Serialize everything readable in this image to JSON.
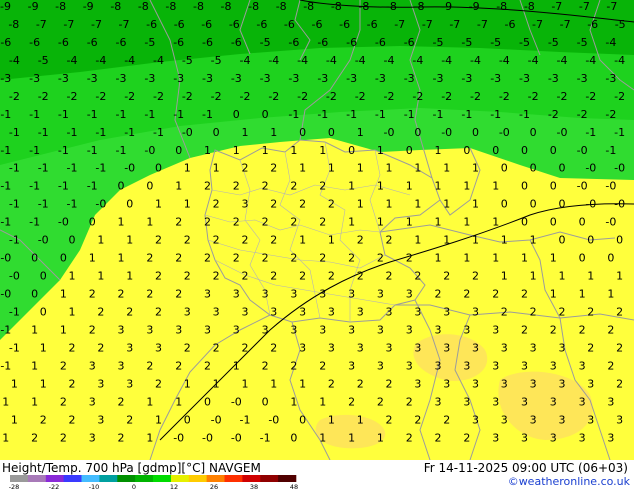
{
  "title": {
    "left": "Height/Temp. 700 hPa [gdmp][°C] NAVGEM",
    "right": "Fr 14-11-2025 09:00 UTC (06+03)"
  },
  "credit": "©weatheronline.co.uk",
  "colorbar": {
    "labels": [
      "-28",
      "-22",
      "-10",
      "0",
      "12",
      "26",
      "38",
      "48"
    ],
    "colors": [
      "#9a9a9a",
      "#a87ab8",
      "#8a2ad8",
      "#3a3aff",
      "#44bcff",
      "#00a0a0",
      "#009000",
      "#00b400",
      "#00dc00",
      "#e6f000",
      "#ffcc00",
      "#ff8000",
      "#ff3000",
      "#d00000",
      "#900000",
      "#500000"
    ]
  },
  "palette": {
    "dark_green": "#08b408",
    "mid_green": "#1ed21e",
    "light_green": "#30dc30",
    "yellow": "#ffff3c",
    "orange_yellow": "#fee658",
    "border_gray": "#9c9c9c"
  },
  "isotherm_rows": [
    [
      "-9",
      "-9",
      "-8",
      "-9",
      "-8",
      "-8",
      "-8",
      "-8",
      "-8",
      "-8",
      "-8",
      "-8",
      "-8",
      "-8",
      "-8",
      "-8",
      "-9",
      "-9",
      "-8",
      "-8",
      "-7",
      "-7",
      "-7"
    ],
    [
      "-8",
      "-7",
      "-7",
      "-7",
      "-7",
      "-6",
      "-6",
      "-6",
      "-6",
      "-6",
      "-6",
      "-6",
      "-6",
      "-6",
      "-7",
      "-7",
      "-7",
      "-7",
      "-6",
      "-7",
      "-7",
      "-6",
      "-5"
    ],
    [
      "-6",
      "-6",
      "-6",
      "-6",
      "-6",
      "-5",
      "-6",
      "-6",
      "-6",
      "-5",
      "-6",
      "-6",
      "-6",
      "-6",
      "-6",
      "-5",
      "-5",
      "-5",
      "-5",
      "-5",
      "-5",
      "-4"
    ],
    [
      "-4",
      "-5",
      "-4",
      "-4",
      "-4",
      "-4",
      "-5",
      "-5",
      "-4",
      "-4",
      "-4",
      "-4",
      "-4",
      "-4",
      "-4",
      "-4",
      "-4",
      "-4",
      "-4",
      "-4",
      "-4",
      "-4"
    ],
    [
      "-3",
      "-3",
      "-3",
      "-3",
      "-3",
      "-3",
      "-3",
      "-3",
      "-3",
      "-3",
      "-3",
      "-3",
      "-3",
      "-3",
      "-3",
      "-3",
      "-3",
      "-3",
      "-3",
      "-3",
      "-3",
      "-3"
    ],
    [
      "-2",
      "-2",
      "-2",
      "-2",
      "-2",
      "-2",
      "-2",
      "-2",
      "-2",
      "-2",
      "-2",
      "-2",
      "-2",
      "-2",
      "-2",
      "-2",
      "-2",
      "-2",
      "-2",
      "-2",
      "-2",
      "-2"
    ],
    [
      "-1",
      "-1",
      "-1",
      "-1",
      "-1",
      "-1",
      "-1",
      "-1",
      "0",
      "0",
      "-1",
      "-1",
      "-1",
      "-1",
      "-1",
      "-1",
      "-1",
      "-1",
      "-1",
      "-2",
      "-2",
      "-2"
    ],
    [
      "-1",
      "-1",
      "-1",
      "-1",
      "-1",
      "-1",
      "-0",
      "0",
      "1",
      "1",
      "0",
      "0",
      "1",
      "-0",
      "0",
      "-0",
      "0",
      "-0",
      "0",
      "-0",
      "-1",
      "-1"
    ],
    [
      "-1",
      "-1",
      "-1",
      "-1",
      "-1",
      "-0",
      "0",
      "1",
      "1",
      "1",
      "1",
      "1",
      "0",
      "1",
      "0",
      "1",
      "0",
      "0",
      "0",
      "0",
      "-0",
      "-1"
    ],
    [
      "-1",
      "-1",
      "-1",
      "-1",
      "-0",
      "0",
      "1",
      "1",
      "2",
      "2",
      "1",
      "1",
      "1",
      "1",
      "1",
      "1",
      "1",
      "0",
      "0",
      "0",
      "-0",
      "-0"
    ],
    [
      "-1",
      "-1",
      "-1",
      "-1",
      "0",
      "0",
      "1",
      "2",
      "2",
      "2",
      "2",
      "2",
      "1",
      "1",
      "1",
      "1",
      "1",
      "1",
      "0",
      "0",
      "-0",
      "-0"
    ],
    [
      "-1",
      "-1",
      "-1",
      "-0",
      "0",
      "1",
      "1",
      "2",
      "3",
      "2",
      "2",
      "2",
      "1",
      "1",
      "1",
      "1",
      "1",
      "0",
      "0",
      "0",
      "-0",
      "-0"
    ],
    [
      "-1",
      "-1",
      "-0",
      "0",
      "1",
      "1",
      "2",
      "2",
      "2",
      "2",
      "2",
      "2",
      "1",
      "1",
      "1",
      "1",
      "1",
      "1",
      "0",
      "0",
      "0",
      "-0"
    ],
    [
      "-1",
      "-0",
      "0",
      "1",
      "1",
      "2",
      "2",
      "2",
      "2",
      "2",
      "1",
      "1",
      "2",
      "2",
      "1",
      "1",
      "1",
      "1",
      "1",
      "0",
      "0",
      "0"
    ],
    [
      "-0",
      "0",
      "0",
      "1",
      "1",
      "2",
      "2",
      "2",
      "2",
      "2",
      "2",
      "2",
      "2",
      "2",
      "2",
      "1",
      "1",
      "1",
      "1",
      "1",
      "0",
      "0"
    ],
    [
      "-0",
      "0",
      "1",
      "1",
      "1",
      "2",
      "2",
      "2",
      "2",
      "2",
      "2",
      "2",
      "2",
      "2",
      "2",
      "2",
      "2",
      "1",
      "1",
      "1",
      "1",
      "1"
    ],
    [
      "-0",
      "0",
      "1",
      "2",
      "2",
      "2",
      "2",
      "3",
      "3",
      "3",
      "3",
      "3",
      "3",
      "3",
      "3",
      "2",
      "2",
      "2",
      "2",
      "1",
      "1",
      "1"
    ],
    [
      "-1",
      "0",
      "1",
      "2",
      "2",
      "2",
      "3",
      "3",
      "3",
      "3",
      "3",
      "3",
      "3",
      "3",
      "3",
      "3",
      "3",
      "2",
      "2",
      "2",
      "2",
      "2"
    ],
    [
      "-1",
      "1",
      "1",
      "2",
      "3",
      "3",
      "3",
      "3",
      "3",
      "3",
      "3",
      "3",
      "3",
      "3",
      "3",
      "3",
      "3",
      "3",
      "2",
      "2",
      "2",
      "2"
    ],
    [
      "-1",
      "1",
      "2",
      "2",
      "3",
      "3",
      "2",
      "2",
      "2",
      "2",
      "3",
      "3",
      "3",
      "3",
      "3",
      "3",
      "3",
      "3",
      "3",
      "3",
      "2",
      "2"
    ],
    [
      "-1",
      "1",
      "2",
      "3",
      "3",
      "2",
      "2",
      "2",
      "1",
      "2",
      "2",
      "2",
      "3",
      "3",
      "3",
      "3",
      "3",
      "3",
      "3",
      "3",
      "3",
      "2"
    ],
    [
      "1",
      "1",
      "2",
      "3",
      "3",
      "2",
      "1",
      "1",
      "1",
      "1",
      "1",
      "2",
      "2",
      "2",
      "3",
      "3",
      "3",
      "3",
      "3",
      "3",
      "3",
      "2"
    ],
    [
      "1",
      "1",
      "2",
      "3",
      "2",
      "1",
      "1",
      "0",
      "-0",
      "0",
      "1",
      "1",
      "2",
      "2",
      "2",
      "3",
      "3",
      "3",
      "3",
      "3",
      "3",
      "3"
    ],
    [
      "1",
      "2",
      "2",
      "3",
      "2",
      "1",
      "0",
      "-0",
      "-1",
      "-0",
      "0",
      "1",
      "1",
      "2",
      "2",
      "2",
      "3",
      "3",
      "3",
      "3",
      "3",
      "3"
    ],
    [
      "1",
      "2",
      "2",
      "3",
      "2",
      "1",
      "-0",
      "-0",
      "-0",
      "-1",
      "0",
      "1",
      "1",
      "1",
      "2",
      "2",
      "2",
      "3",
      "3",
      "3",
      "3",
      "3"
    ]
  ]
}
